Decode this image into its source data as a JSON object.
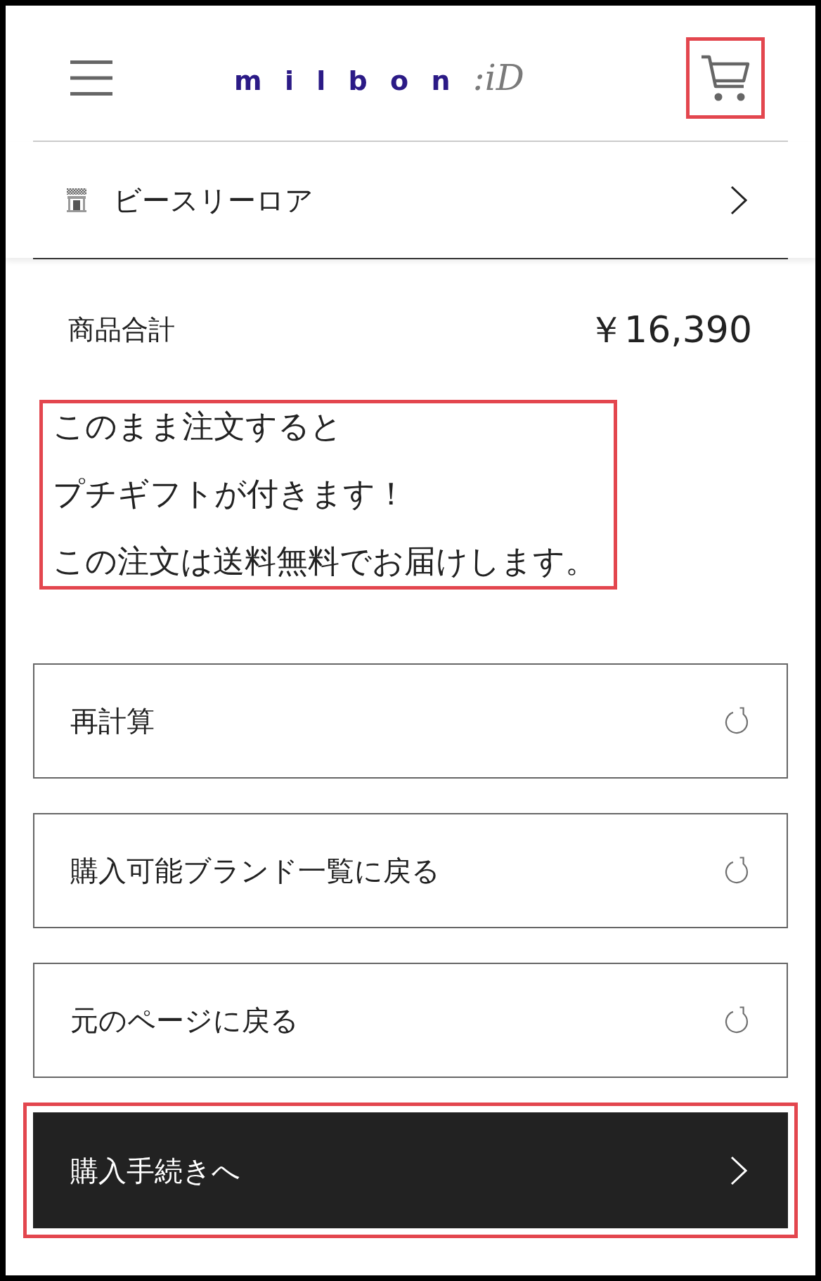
{
  "header": {
    "logo": {
      "wordmark": "milbon",
      "suffix": ":iD"
    },
    "cart_highlighted": true
  },
  "store": {
    "name": "ビースリーロア"
  },
  "total": {
    "label": "商品合計",
    "amount": "￥16,390"
  },
  "message": {
    "highlighted": true,
    "lines": [
      "このまま注文すると",
      "プチギフトが付きます！",
      "この注文は送料無料でお届けします。"
    ]
  },
  "actions": [
    {
      "label": "再計算",
      "kind": "refresh"
    },
    {
      "label": "購入可能ブランド一覧に戻る",
      "kind": "refresh"
    },
    {
      "label": "元のページに戻る",
      "kind": "refresh"
    }
  ],
  "checkout": {
    "label": "購入手続きへ",
    "highlighted": true
  }
}
